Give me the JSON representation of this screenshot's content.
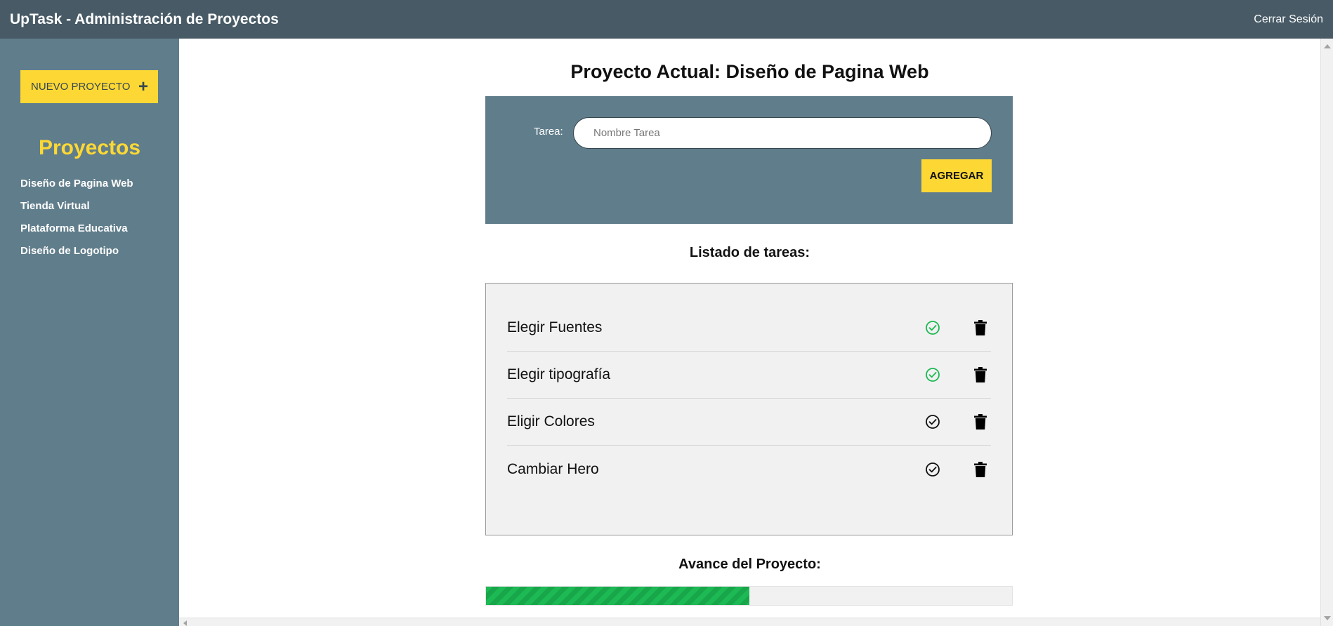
{
  "header": {
    "title": "UpTask - Administración de Proyectos",
    "logout_label": "Cerrar Sesión"
  },
  "sidebar": {
    "new_project_label": "NUEVO PROYECTO",
    "new_project_icon": "plus-icon",
    "projects_title": "Proyectos",
    "projects": [
      {
        "label": "Diseño de Pagina Web"
      },
      {
        "label": "Tienda Virtual"
      },
      {
        "label": "Plataforma Educativa"
      },
      {
        "label": "Diseño de Logotipo"
      }
    ]
  },
  "main": {
    "current_project_label": "Proyecto Actual:",
    "current_project_name": "Diseño de Pagina Web",
    "form": {
      "task_label": "Tarea:",
      "task_placeholder": "Nombre Tarea",
      "task_value": "",
      "add_label": "AGREGAR"
    },
    "tasks_heading": "Listado de tareas:",
    "tasks": [
      {
        "name": "Elegir Fuentes",
        "completed": true
      },
      {
        "name": "Elegir tipografía",
        "completed": true
      },
      {
        "name": "Eligir Colores",
        "completed": false
      },
      {
        "name": "Cambiar Hero",
        "completed": false
      }
    ],
    "progress_heading": "Avance del Proyecto:",
    "progress": 0.5
  },
  "colors": {
    "header_bg": "#475a66",
    "sidebar_bg": "#607d8b",
    "accent_yellow": "#fdd835",
    "check_completed": "#1db954",
    "check_pending": "#111111",
    "progress_green": "#1db954"
  }
}
